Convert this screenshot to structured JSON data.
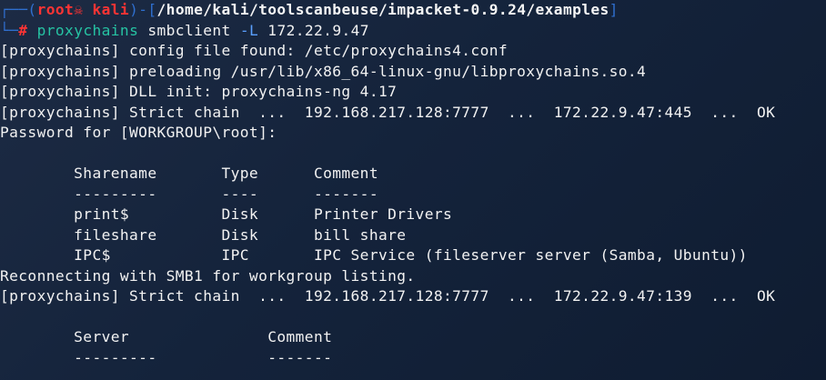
{
  "prompt": {
    "box_open": "┌──(",
    "user": "root",
    "skull": "☠",
    "host": "kali",
    "box_mid": ")-[",
    "path": "/home/kali/toolscanbeuse/impacket-0.9.24/examples",
    "box_close": "]",
    "box_lower": "└─",
    "hash": "#",
    "command": "proxychains",
    "subcommand": "smbclient",
    "flag": "-L",
    "target": "172.22.9.47"
  },
  "output": [
    "[proxychains] config file found: /etc/proxychains4.conf",
    "[proxychains] preloading /usr/lib/x86_64-linux-gnu/libproxychains.so.4",
    "[proxychains] DLL init: proxychains-ng 4.17",
    "[proxychains] Strict chain  ...  192.168.217.128:7777  ...  172.22.9.47:445  ...  OK",
    "Password for [WORKGROUP\\root]:",
    "",
    "        Sharename       Type      Comment",
    "        ---------       ----      -------",
    "        print$          Disk      Printer Drivers",
    "        fileshare       Disk      bill share",
    "        IPC$            IPC       IPC Service (fileserver server (Samba, Ubuntu))",
    "Reconnecting with SMB1 for workgroup listing.",
    "[proxychains] Strict chain  ...  192.168.217.128:7777  ...  172.22.9.47:139  ...  OK",
    "",
    "        Server               Comment",
    "        ---------            -------"
  ]
}
